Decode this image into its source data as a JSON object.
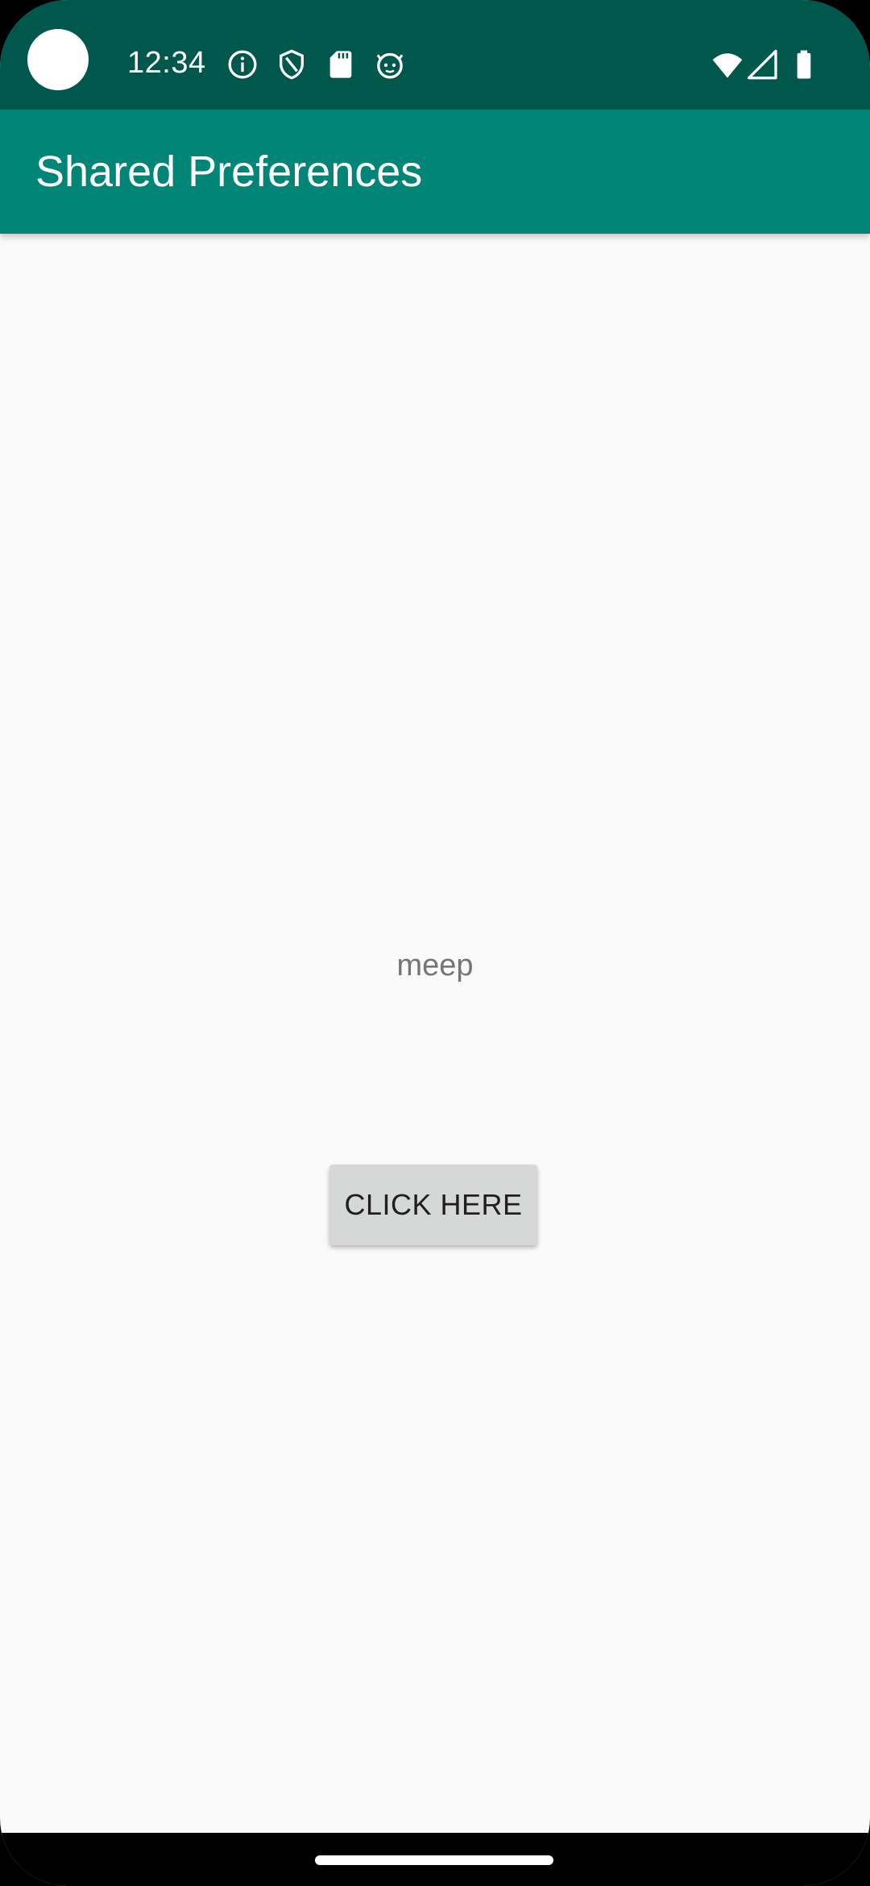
{
  "status_bar": {
    "time": "12:34",
    "icons": [
      "info-icon",
      "shield-icon",
      "sd-card-icon",
      "android-face-icon",
      "wifi-icon",
      "signal-icon",
      "battery-icon"
    ]
  },
  "app_bar": {
    "title": "Shared Preferences",
    "color": "#008577",
    "status_color": "#00574b"
  },
  "main": {
    "label": "meep",
    "button_label": "CLICK HERE"
  }
}
